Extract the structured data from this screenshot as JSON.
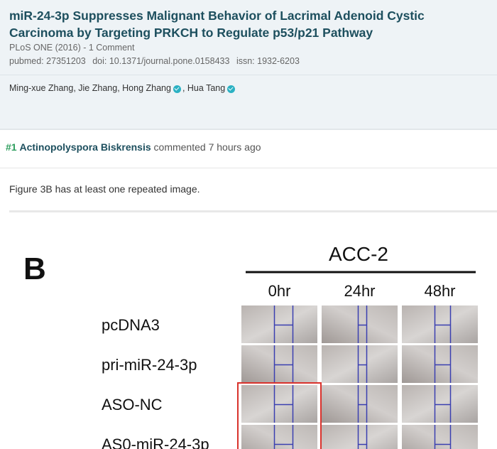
{
  "paper": {
    "title": "miR-24-3p Suppresses Malignant Behavior of Lacrimal Adenoid Cystic Carcinoma by Targeting PRKCH to Regulate p53/p21 Pathway",
    "journal_line": "PLoS ONE (2016) - 1 Comment",
    "pubmed": "pubmed: 27351203",
    "doi": "doi: 10.1371/journal.pone.0158433",
    "issn": "issn: 1932-6203",
    "authors": [
      {
        "name": "Ming-xue Zhang",
        "sep": ", ",
        "verified": false
      },
      {
        "name": "Jie Zhang",
        "sep": ", ",
        "verified": false
      },
      {
        "name": "Hong Zhang",
        "sep": ", ",
        "verified": true
      },
      {
        "name": "Hua Tang",
        "sep": "",
        "verified": true
      }
    ]
  },
  "comment": {
    "number": "#1",
    "author": "Actinopolyspora Biskrensis",
    "meta": "commented 7 hours ago",
    "text": "Figure 3B has at least one repeated image."
  },
  "figure": {
    "panel_label": "B",
    "cell_line": "ACC-2",
    "timepoints": [
      "0hr",
      "24hr",
      "48hr"
    ],
    "conditions": [
      "pcDNA3",
      "pri-miR-24-3p",
      "ASO-NC",
      "AS0-miR-24-3p"
    ],
    "highlight_color": "#d9322c"
  }
}
